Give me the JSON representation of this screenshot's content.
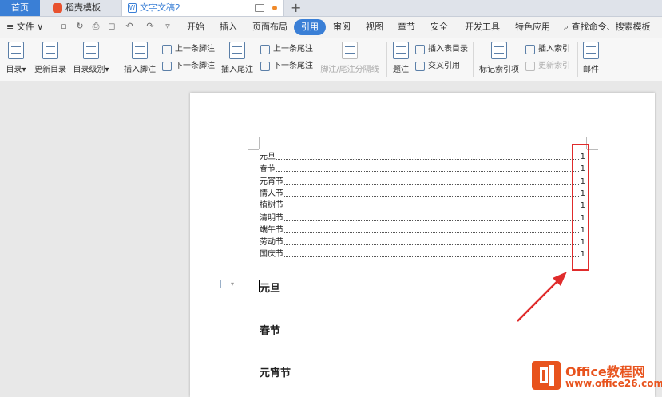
{
  "tabs": {
    "home": "首页",
    "template": "稻壳模板",
    "document": "文字文稿2",
    "doc_icon": "W",
    "new_tab": "+"
  },
  "menu": {
    "file": "≡ 文件 ∨",
    "items": [
      "开始",
      "插入",
      "页面布局",
      "引用",
      "审阅",
      "视图",
      "章节",
      "安全",
      "开发工具",
      "特色应用"
    ],
    "active": "引用",
    "search": "查找命令、搜索模板"
  },
  "ribbon": {
    "toc": "目录",
    "update_toc": "更新目录",
    "toc_level": "目录级别",
    "insert_footnote": "插入脚注",
    "prev_footnote": "上一条脚注",
    "next_footnote": "下一条脚注",
    "insert_endnote": "插入尾注",
    "prev_endnote": "上一条尾注",
    "next_endnote": "下一条尾注",
    "note_separator": "脚注/尾注分隔线",
    "caption": "题注",
    "insert_table_of_figures": "插入表目录",
    "cross_reference": "交叉引用",
    "mark_index": "标记索引项",
    "insert_index": "插入索引",
    "update_index": "更新索引",
    "mail": "邮件"
  },
  "document": {
    "toc": [
      {
        "title": "元旦",
        "page": "1"
      },
      {
        "title": "春节",
        "page": "1"
      },
      {
        "title": "元宵节",
        "page": "1"
      },
      {
        "title": "情人节",
        "page": "1"
      },
      {
        "title": "植树节",
        "page": "1"
      },
      {
        "title": "清明节",
        "page": "1"
      },
      {
        "title": "端午节",
        "page": "1"
      },
      {
        "title": "劳动节",
        "page": "1"
      },
      {
        "title": "国庆节",
        "page": "1"
      }
    ],
    "headings": [
      "元旦",
      "春节",
      "元宵节"
    ]
  },
  "annotation": {
    "box_color": "#e02c2c"
  },
  "watermark": {
    "line1": "Office教程网",
    "line2": "www.office26.com"
  }
}
